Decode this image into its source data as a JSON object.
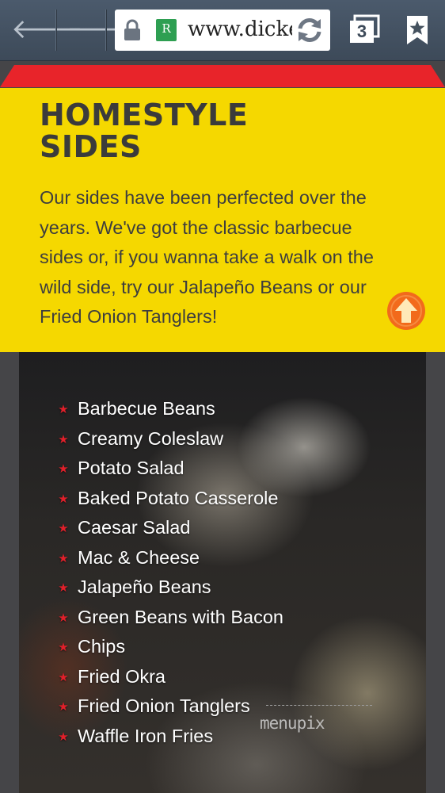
{
  "browser": {
    "url": "www.dicke",
    "tab_count": "3",
    "favicon_letter": "R",
    "icons": {
      "back": "arrow-left-icon",
      "forward": "arrow-right-icon",
      "secure": "lock-icon",
      "reload": "reload-icon",
      "tabs": "tabs-icon",
      "bookmark": "bookmark-star-icon"
    }
  },
  "section": {
    "heading_line1": "HOMESTYLE",
    "heading_line2": "SIDES",
    "intro": "Our sides have been perfected over the years. We've got the classic barbecue sides or, if you wanna take a walk on the wild side, try our Jalapeño Beans or our Fried Onion Tanglers!",
    "scroll_up_icon": "arrow-up-circle-icon"
  },
  "sides": [
    "Barbecue Beans",
    "Creamy Coleslaw",
    "Potato Salad",
    "Baked Potato Casserole",
    "Caesar Salad",
    "Mac & Cheese",
    "Jalapeño Beans",
    "Green Beans with Bacon",
    "Chips",
    "Fried Okra",
    "Fried Onion Tanglers",
    "Waffle Iron Fries"
  ],
  "watermark": "menupix",
  "colors": {
    "toolbar": "#45525f",
    "panel_yellow": "#f5d800",
    "band_red": "#e8242a",
    "heading": "#3b3b3b",
    "bullet_star": "#e0202a",
    "up_button": "#f26a1b"
  }
}
